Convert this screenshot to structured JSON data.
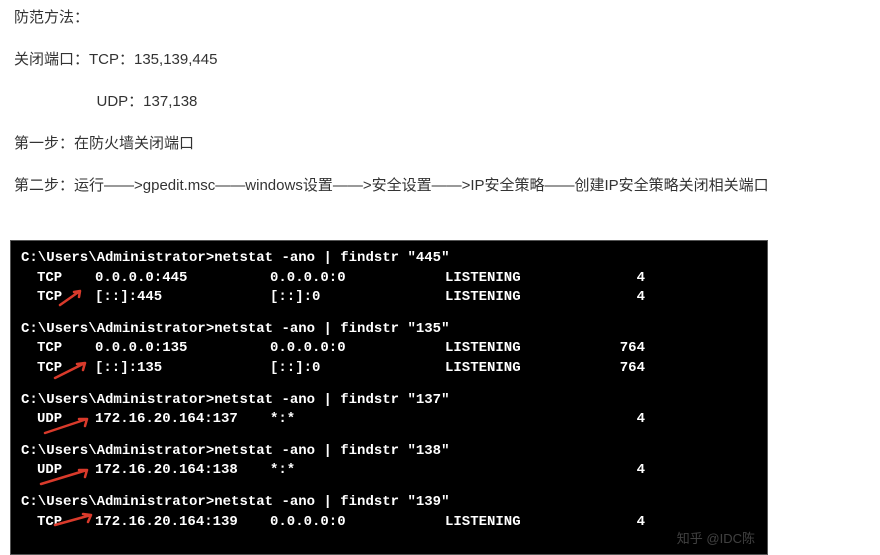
{
  "article": {
    "p1": "防范方法：",
    "p2": "关闭端口：TCP：135,139,445",
    "p2_indent_label": "UDP：137,138",
    "p3": "第一步：在防火墙关闭端口",
    "p4": "第二步：运行——>gpedit.msc——windows设置——>安全设置——>IP安全策略——创建IP安全策略关闭相关端口"
  },
  "terminal": {
    "prompt": "C:\\Users\\Administrator>",
    "cmd_prefix": "netstat -ano | findstr ",
    "blocks": [
      {
        "port": "\"445\"",
        "rows": [
          {
            "proto": "TCP",
            "local": "0.0.0.0:445",
            "remote": "0.0.0.0:0",
            "state": "LISTENING",
            "pid": "4"
          },
          {
            "proto": "TCP",
            "local": "[::]:445",
            "remote": "[::]:0",
            "state": "LISTENING",
            "pid": "4"
          }
        ]
      },
      {
        "port": "\"135\"",
        "rows": [
          {
            "proto": "TCP",
            "local": "0.0.0.0:135",
            "remote": "0.0.0.0:0",
            "state": "LISTENING",
            "pid": "764"
          },
          {
            "proto": "TCP",
            "local": "[::]:135",
            "remote": "[::]:0",
            "state": "LISTENING",
            "pid": "764"
          }
        ]
      },
      {
        "port": "\"137\"",
        "rows": [
          {
            "proto": "UDP",
            "local": "172.16.20.164:137",
            "remote": "*:*",
            "state": "",
            "pid": "4"
          }
        ]
      },
      {
        "port": "\"138\"",
        "rows": [
          {
            "proto": "UDP",
            "local": "172.16.20.164:138",
            "remote": "*:*",
            "state": "",
            "pid": "4"
          }
        ]
      },
      {
        "port": "\"139\"",
        "rows": [
          {
            "proto": "TCP",
            "local": "172.16.20.164:139",
            "remote": "0.0.0.0:0",
            "state": "LISTENING",
            "pid": "4"
          }
        ]
      }
    ]
  },
  "watermark": "知乎 @IDC陈",
  "colors": {
    "arrow": "#d93a2b"
  }
}
